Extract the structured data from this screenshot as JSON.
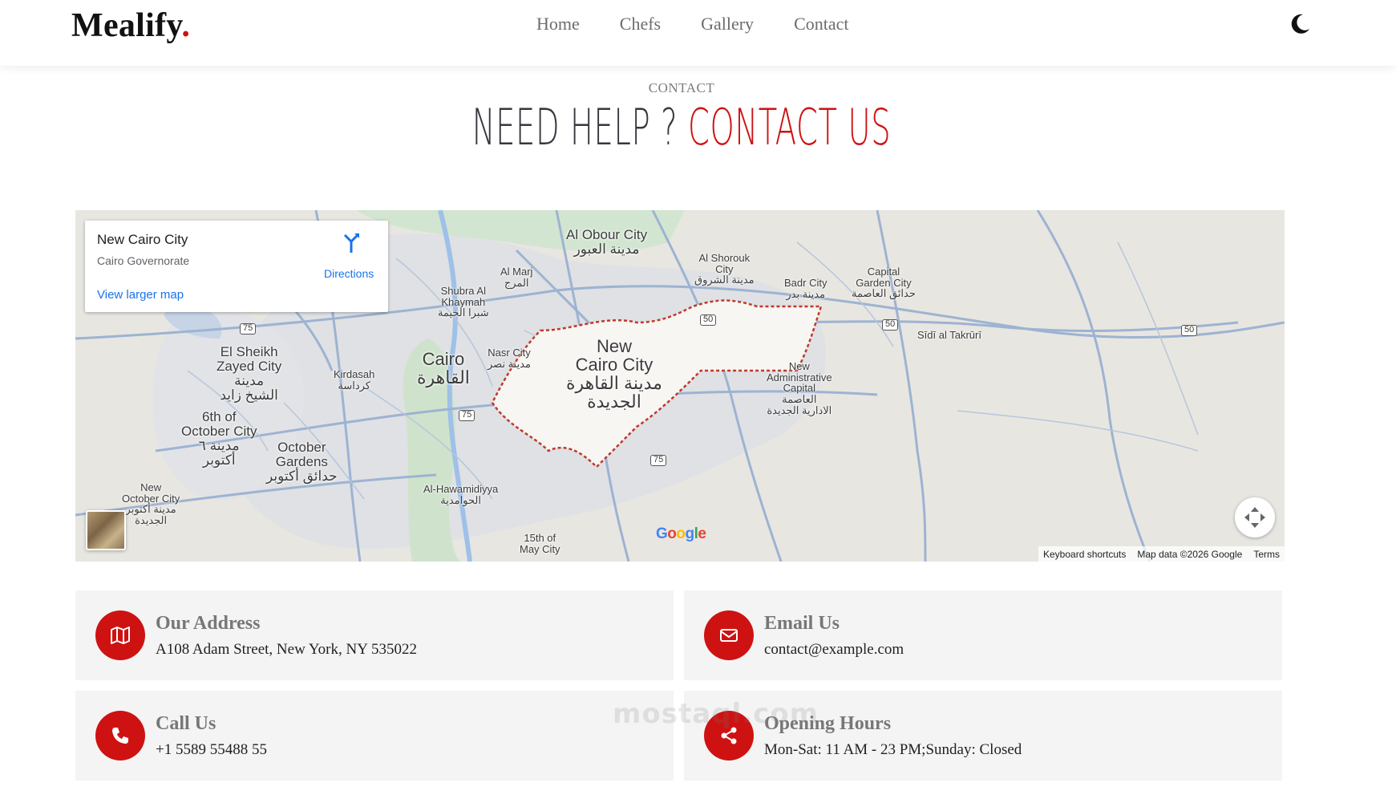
{
  "brand": {
    "name": "Mealify",
    "dot": "."
  },
  "nav": [
    "Home",
    "Chefs",
    "Gallery",
    "Contact"
  ],
  "section": {
    "label": "CONTACT",
    "heading_main": "NEED HELP ?",
    "heading_accent": "CONTACT US"
  },
  "map": {
    "place_title": "New Cairo City",
    "place_subtitle": "Cairo Governorate",
    "larger_map_link": "View larger map",
    "directions_label": "Directions",
    "google_logo": "Google",
    "attribution": [
      "Keyboard shortcuts",
      "Map data ©2026 Google",
      "Terms"
    ],
    "labels": {
      "obour": "Al Obour City\nمدينة العبور",
      "marj": "Al Marj\nالمرج",
      "shubra": "Shubra Al\nKhaymah\nشبرا الخيمة",
      "shorouk": "Al Shorouk\nCity\nمدينة الشروق",
      "badr": "Badr City\nمدينة بدر",
      "capital_garden": "Capital\nGarden City\nحدائق العاصمة",
      "sidi": "Sīdī al Takrūrī",
      "sheikh_zayed": "El Sheikh\nZayed City\nمدينة\nالشيخ زايد",
      "cairo": "Cairo\nالقاهرة",
      "nasr": "Nasr City\nمدينة نصر",
      "kirdasah": "Kirdasah\nكرداسة",
      "new_cairo": "New\nCairo City\nمدينة القاهرة\nالجديدة",
      "new_capital": "New\nAdministrative\nCapital\nالعاصمة\nالادارية الجديدة",
      "october": "6th of\nOctober City\nمدينة ٦\nأكتوبر",
      "october_gardens": "October\nGardens\nحدائق أكتوبر",
      "new_october": "New\nOctober City\nمدينة أكتوبر\nالجديدة",
      "hawamdiya": "Al-Hawamidiyya\nالحوامدية",
      "may": "15th of\nMay City"
    },
    "shields": [
      "75",
      "75",
      "75",
      "50",
      "50",
      "50"
    ]
  },
  "info": [
    {
      "title": "Our Address",
      "text": "A108 Adam Street, New York, NY 535022",
      "icon": "map-icon"
    },
    {
      "title": "Email Us",
      "text": "contact@example.com",
      "icon": "envelope-icon"
    },
    {
      "title": "Call Us",
      "text": "+1 5589 55488 55",
      "icon": "phone-icon"
    },
    {
      "title": "Opening Hours",
      "text": "Mon-Sat: 11 AM - 23 PM;Sunday: Closed",
      "icon": "share-icon"
    }
  ],
  "watermark": "mostaql.com",
  "colors": {
    "accent": "#ce1212",
    "map_bg": "#e8e6e1",
    "link": "#1a73e8"
  }
}
